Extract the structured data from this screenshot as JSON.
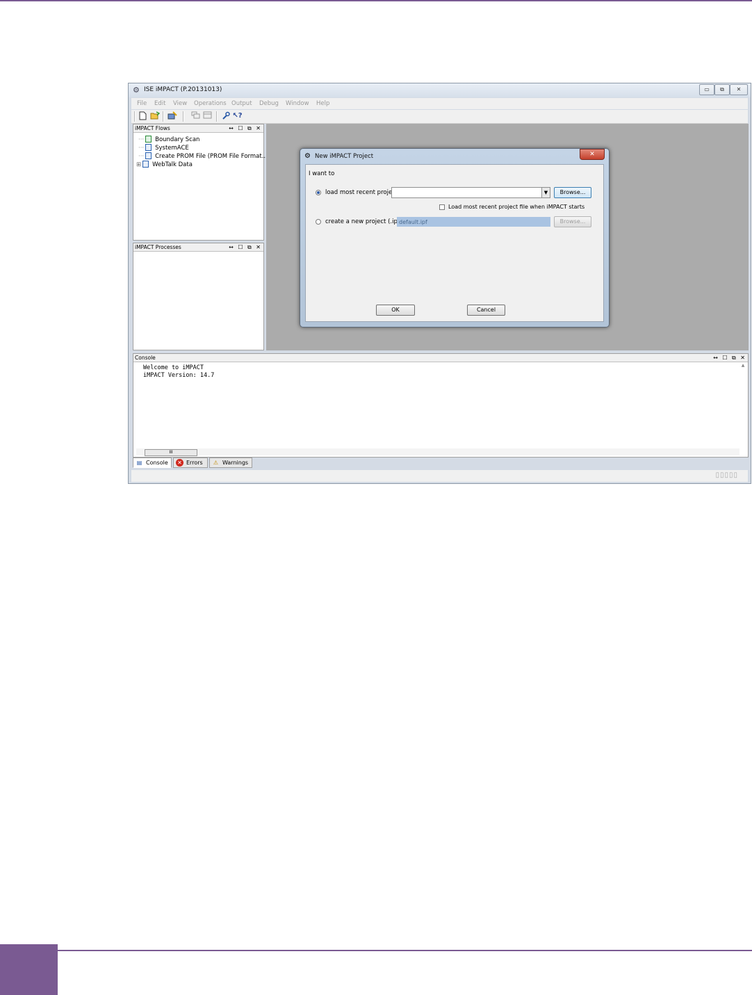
{
  "window": {
    "title": "ISE iMPACT (P.20131013)",
    "controls": {
      "minimize": "▭",
      "restore": "⧉",
      "close": "✕"
    }
  },
  "menu": [
    "File",
    "Edit",
    "View",
    "Operations",
    "Output",
    "Debug",
    "Window",
    "Help"
  ],
  "toolbar": {
    "icons": [
      "new-icon",
      "open-icon",
      "save-icon",
      "cascade-icon",
      "tile-icon",
      "wrench-icon",
      "help-icon"
    ]
  },
  "panels": {
    "flows": {
      "title": "iMPACT Flows",
      "controls": "↔ ☐ ⧉ ✕",
      "items": [
        "Boundary Scan",
        "SystemACE",
        "Create PROM File (PROM File Format...",
        "WebTalk Data"
      ],
      "expander": "⊞"
    },
    "processes": {
      "title": "iMPACT Processes",
      "controls": "↔ ☐ ⧉ ✕"
    }
  },
  "dialog": {
    "title": "New iMPACT Project",
    "close": "✕",
    "prompt": "I want to",
    "option_load": "load most recent project",
    "load_value": "",
    "browse": "Browse...",
    "checkbox_label": "Load most recent project file when iMPACT starts",
    "option_create": "create a new project (.ipf)",
    "create_value": "default.ipf",
    "browse_disabled": "Browse...",
    "ok": "OK",
    "cancel": "Cancel",
    "selected_option": "load"
  },
  "console": {
    "title": "Console",
    "controls": "↔ ☐ ⧉ ✕",
    "lines": "Welcome to iMPACT\niMPACT Version: 14.7",
    "scroll_thumb": "III"
  },
  "tabs": [
    "Console",
    "Errors",
    "Warnings"
  ],
  "colors": {
    "accent": "#7a5a92",
    "selection": "#a9c3e2",
    "workspace": "#ababab"
  }
}
